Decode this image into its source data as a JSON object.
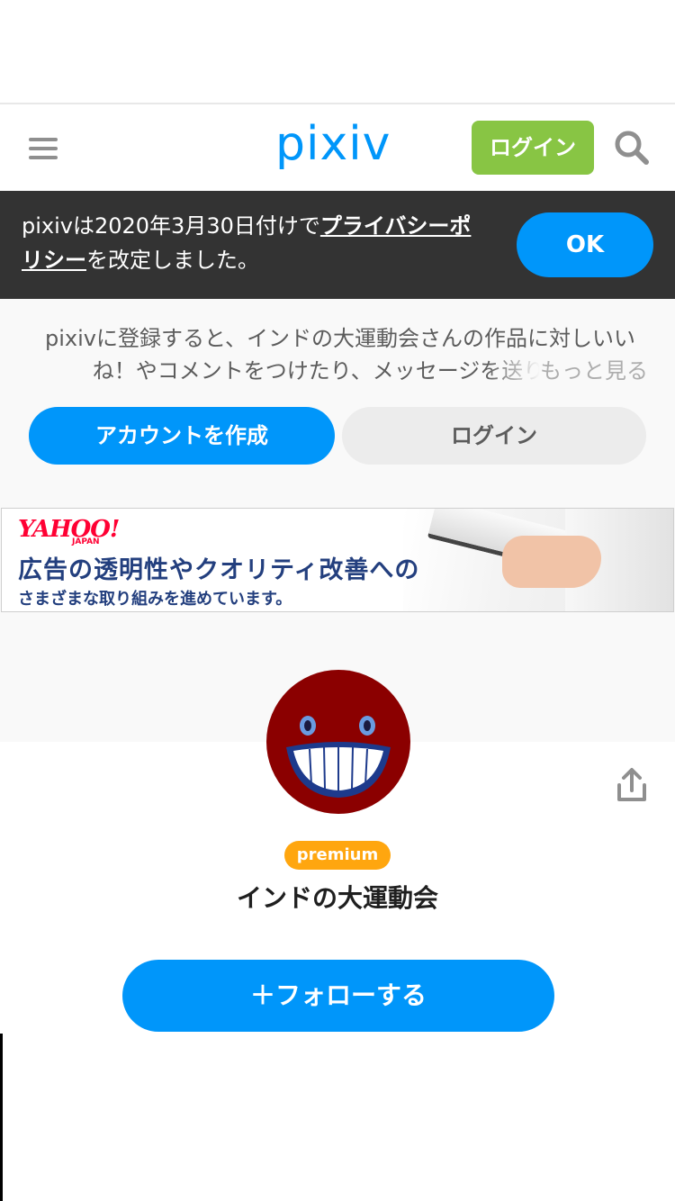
{
  "header": {
    "logo": "pixiv",
    "login_label": "ログイン",
    "menu_icon": "hamburger-menu-icon",
    "search_icon": "search-icon"
  },
  "privacy_notice": {
    "text_before": "pixivは2020年3月30日付けで",
    "link_text": "プライバシーポリシー",
    "text_after": "を改定しました。",
    "ok_label": "OK"
  },
  "register_prompt": {
    "text": "pixivに登録すると、インドの大運動会さんの作品に対しいいね！やコメントをつけたり、メッセージを送り交流",
    "more_label": "もっと見る",
    "create_account_label": "アカウントを作成",
    "login_label": "ログイン"
  },
  "ad": {
    "brand": "YAHOO!",
    "brand_sub": "JAPAN",
    "line1": "広告の透明性やクオリティ改善への",
    "line2": "さまざまな取り組みを進めています。"
  },
  "profile": {
    "badge": "premium",
    "name": "インドの大運動会",
    "follow_label": "＋フォローする",
    "share_icon": "share-icon"
  },
  "colors": {
    "brand_blue": "#0096fa",
    "login_green": "#88c544",
    "premium_orange": "#ffa60f",
    "notice_bg": "#333333",
    "avatar_red": "#8b0000"
  }
}
